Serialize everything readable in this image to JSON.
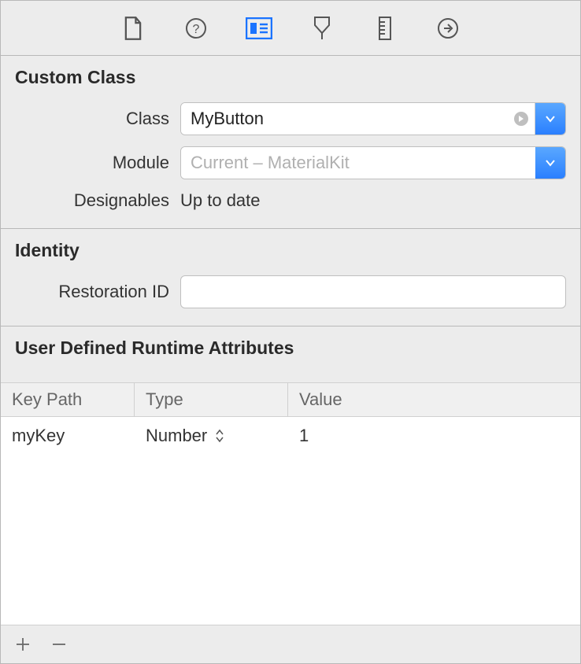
{
  "toolbar": {
    "active_index": 2
  },
  "custom_class": {
    "title": "Custom Class",
    "class_label": "Class",
    "class_value": "MyButton",
    "module_label": "Module",
    "module_placeholder": "Current – MaterialKit",
    "designables_label": "Designables",
    "designables_value": "Up to date"
  },
  "identity": {
    "title": "Identity",
    "restoration_label": "Restoration ID",
    "restoration_value": ""
  },
  "runtime_attributes": {
    "title": "User Defined Runtime Attributes",
    "columns": {
      "key": "Key Path",
      "type": "Type",
      "value": "Value"
    },
    "rows": [
      {
        "key": "myKey",
        "type": "Number",
        "value": "1"
      }
    ]
  }
}
